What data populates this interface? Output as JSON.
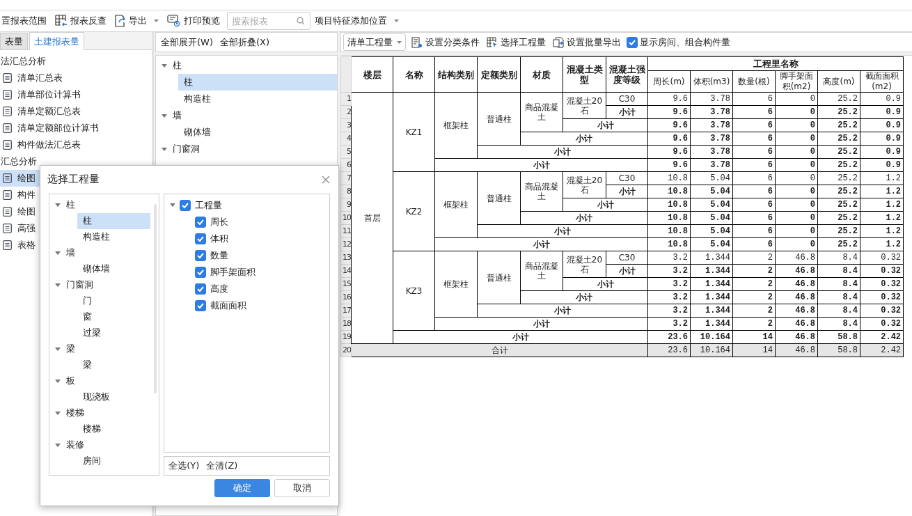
{
  "toolbar": {
    "buttons": [
      {
        "label": "置报表范围",
        "kind": "plain"
      },
      {
        "label": "报表反查",
        "kind": "icon"
      },
      {
        "label": "导出",
        "kind": "menu"
      },
      {
        "label": "打印预览",
        "kind": "icon"
      }
    ],
    "search": {
      "placeholder": "搜索报表"
    },
    "feature_dropdown": {
      "value": "项目特征添加位置"
    }
  },
  "left_panel": {
    "tabs": [
      {
        "label": "表量",
        "selected": false
      },
      {
        "label": "土建报表量",
        "selected": true
      }
    ],
    "groups": [
      {
        "label": "法汇总分析",
        "items": [
          {
            "label": "清单汇总表",
            "selected": false
          },
          {
            "label": "清单部位计算书",
            "selected": false
          },
          {
            "label": "清单定额汇总表",
            "selected": false
          },
          {
            "label": "清单定额部位计算书",
            "selected": false
          },
          {
            "label": "构件做法汇总表",
            "selected": false
          }
        ]
      },
      {
        "label": "汇总分析",
        "items": [
          {
            "label": "绘图",
            "selected": true
          },
          {
            "label": "构件",
            "selected": false
          },
          {
            "label": "绘图",
            "selected": false
          },
          {
            "label": "高强",
            "selected": false
          },
          {
            "label": "表格",
            "selected": false
          }
        ]
      }
    ]
  },
  "component_panel": {
    "actions": [
      "全部展开(W)",
      "全部折叠(X)"
    ],
    "tree": [
      {
        "label": "柱",
        "expanded": true,
        "selected": false,
        "children": [
          {
            "label": "柱",
            "selected": true
          },
          {
            "label": "构造柱",
            "selected": false
          }
        ]
      },
      {
        "label": "墙",
        "expanded": true,
        "selected": false,
        "children": [
          {
            "label": "砌体墙",
            "selected": false
          }
        ]
      },
      {
        "label": "门窗洞",
        "expanded": true,
        "selected": false
      }
    ]
  },
  "report": {
    "quantity_dropdown": {
      "value": "清单工程量"
    },
    "actions": [
      "设置分类条件",
      "选择工程量",
      "设置批量导出"
    ],
    "show_rooms": {
      "label": "显示房间、组合构件量",
      "checked": true
    },
    "table": {
      "columns": [
        "楼层",
        "名称",
        "结构类别",
        "定额类别",
        "材质",
        "混凝土类型",
        "混凝土强度等级"
      ],
      "group_header": "工程里名称",
      "quantity_columns": [
        "周长(m)",
        "体积(m3)",
        "数量(根)",
        "脚手架面积(m2)",
        "高度(m)",
        "截面面积(m2)"
      ],
      "row_numbers": [
        "1",
        "2",
        "3",
        "4",
        "5",
        "6",
        "7",
        "8",
        "9",
        "10",
        "11",
        "12",
        "13",
        "14",
        "15",
        "16",
        "17",
        "18",
        "19",
        "20"
      ],
      "floors": [
        {
          "floor": "首层",
          "members": [
            {
              "name": "KZ1",
              "structure": "框架柱",
              "quota": "普通柱",
              "material": "商品混凝土",
              "concrete": "混凝土20石",
              "grade": "C30",
              "values": [
                "9.6",
                "3.78",
                "6",
                "0",
                "25.2",
                "0.9"
              ],
              "subtotals": [
                {
                  "label": "小计",
                  "values": [
                    "9.6",
                    "3.78",
                    "6",
                    "0",
                    "25.2",
                    "0.9"
                  ]
                },
                {
                  "label": "小计",
                  "values": [
                    "9.6",
                    "3.78",
                    "6",
                    "0",
                    "25.2",
                    "0.9"
                  ]
                },
                {
                  "label": "小计",
                  "values": [
                    "9.6",
                    "3.78",
                    "6",
                    "0",
                    "25.2",
                    "0.9"
                  ]
                },
                {
                  "label": "小计",
                  "values": [
                    "9.6",
                    "3.78",
                    "6",
                    "0",
                    "25.2",
                    "0.9"
                  ]
                },
                {
                  "label": "小计",
                  "values": [
                    "9.6",
                    "3.78",
                    "6",
                    "0",
                    "25.2",
                    "0.9"
                  ]
                }
              ]
            },
            {
              "name": "KZ2",
              "structure": "框架柱",
              "quota": "普通柱",
              "material": "商品混凝土",
              "concrete": "混凝土20石",
              "grade": "C30",
              "values": [
                "10.8",
                "5.04",
                "6",
                "0",
                "25.2",
                "1.2"
              ],
              "subtotals": [
                {
                  "label": "小计",
                  "values": [
                    "10.8",
                    "5.04",
                    "6",
                    "0",
                    "25.2",
                    "1.2"
                  ]
                },
                {
                  "label": "小计",
                  "values": [
                    "10.8",
                    "5.04",
                    "6",
                    "0",
                    "25.2",
                    "1.2"
                  ]
                },
                {
                  "label": "小计",
                  "values": [
                    "10.8",
                    "5.04",
                    "6",
                    "0",
                    "25.2",
                    "1.2"
                  ]
                },
                {
                  "label": "小计",
                  "values": [
                    "10.8",
                    "5.04",
                    "6",
                    "0",
                    "25.2",
                    "1.2"
                  ]
                },
                {
                  "label": "小计",
                  "values": [
                    "10.8",
                    "5.04",
                    "6",
                    "0",
                    "25.2",
                    "1.2"
                  ]
                }
              ]
            },
            {
              "name": "KZ3",
              "structure": "框架柱",
              "quota": "普通柱",
              "material": "商品混凝土",
              "concrete": "混凝土20石",
              "grade": "C30",
              "values": [
                "3.2",
                "1.344",
                "2",
                "46.8",
                "8.4",
                "0.32"
              ],
              "subtotals": [
                {
                  "label": "小计",
                  "values": [
                    "3.2",
                    "1.344",
                    "2",
                    "46.8",
                    "8.4",
                    "0.32"
                  ]
                },
                {
                  "label": "小计",
                  "values": [
                    "3.2",
                    "1.344",
                    "2",
                    "46.8",
                    "8.4",
                    "0.32"
                  ]
                },
                {
                  "label": "小计",
                  "values": [
                    "3.2",
                    "1.344",
                    "2",
                    "46.8",
                    "8.4",
                    "0.32"
                  ]
                },
                {
                  "label": "小计",
                  "values": [
                    "3.2",
                    "1.344",
                    "2",
                    "46.8",
                    "8.4",
                    "0.32"
                  ]
                },
                {
                  "label": "小计",
                  "values": [
                    "3.2",
                    "1.344",
                    "2",
                    "46.8",
                    "8.4",
                    "0.32"
                  ]
                }
              ]
            }
          ],
          "subtotal": {
            "label": "小计",
            "values": [
              "23.6",
              "10.164",
              "14",
              "46.8",
              "58.8",
              "2.42"
            ]
          }
        }
      ],
      "total": {
        "label": "合计",
        "values": [
          "23.6",
          "10.164",
          "14",
          "46.8",
          "58.8",
          "2.42"
        ]
      }
    }
  },
  "dialog": {
    "title": "选择工程量",
    "tree": [
      {
        "label": "柱",
        "expanded": true,
        "selected": false,
        "children": [
          {
            "label": "柱",
            "selected": true
          },
          {
            "label": "构造柱",
            "selected": false
          }
        ]
      },
      {
        "label": "墙",
        "expanded": true,
        "selected": false,
        "children": [
          {
            "label": "砌体墙",
            "selected": false
          }
        ]
      },
      {
        "label": "门窗洞",
        "expanded": true,
        "selected": false,
        "children": [
          {
            "label": "门",
            "selected": false
          },
          {
            "label": "窗",
            "selected": false
          },
          {
            "label": "过梁",
            "selected": false
          }
        ]
      },
      {
        "label": "梁",
        "expanded": true,
        "selected": false,
        "children": [
          {
            "label": "梁",
            "selected": false
          }
        ]
      },
      {
        "label": "板",
        "expanded": true,
        "selected": false,
        "children": [
          {
            "label": "现浇板",
            "selected": false
          }
        ]
      },
      {
        "label": "楼梯",
        "expanded": true,
        "selected": false,
        "children": [
          {
            "label": "楼梯",
            "selected": false
          }
        ]
      },
      {
        "label": "装修",
        "expanded": true,
        "selected": false,
        "children": [
          {
            "label": "房间",
            "selected": false
          }
        ]
      }
    ],
    "quantities": {
      "label": "工程量",
      "checked": true,
      "expanded": true,
      "children": [
        {
          "label": "周长",
          "checked": true
        },
        {
          "label": "体积",
          "checked": true
        },
        {
          "label": "数量",
          "checked": true
        },
        {
          "label": "脚手架面积",
          "checked": true
        },
        {
          "label": "高度",
          "checked": true
        },
        {
          "label": "截面面积",
          "checked": true
        }
      ]
    },
    "links": [
      "全选(Y)",
      "全清(Z)"
    ],
    "buttons": [
      {
        "label": "确定",
        "kind": "primary"
      },
      {
        "label": "取消",
        "kind": "secondary"
      }
    ]
  }
}
